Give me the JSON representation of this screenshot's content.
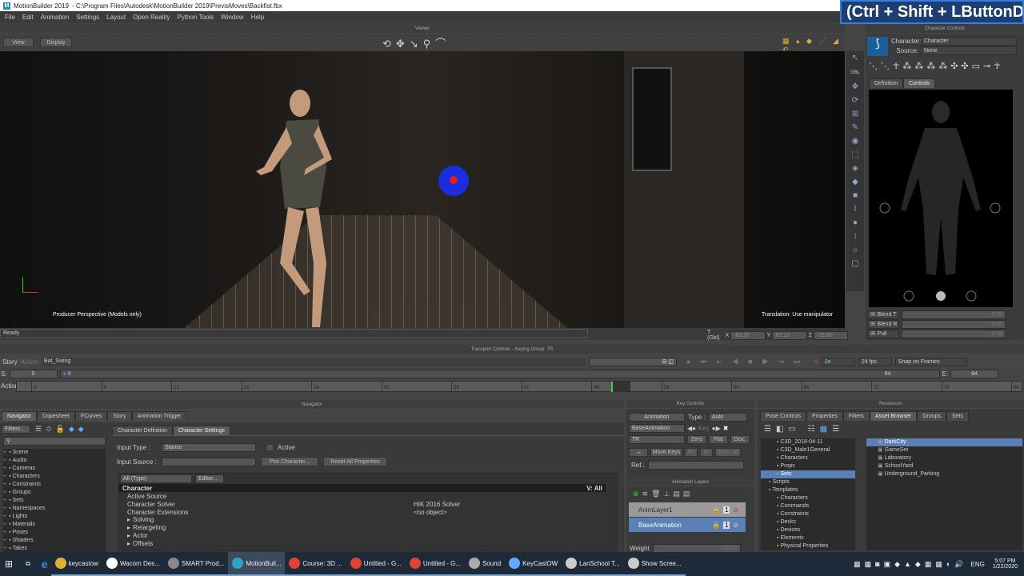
{
  "window": {
    "app_title": "MotionBuilder 2019",
    "file_path": "- C:\\Program Files\\Autodesk\\MotionBuilder 2019\\PrevisMoves\\Backfist.fbx",
    "logo": "M"
  },
  "keycast_overlay": "(Ctrl + Shift + LButtonD",
  "menu": [
    "File",
    "Edit",
    "Animation",
    "Settings",
    "Layout",
    "Open Reality",
    "Python Tools",
    "Window",
    "Help"
  ],
  "viewer": {
    "title": "Viewer",
    "view_btn": "View",
    "display_btn": "Display",
    "camera_label": "Producer Perspective (Models only)",
    "manip_label": "Translation: Use manipulator"
  },
  "status": {
    "text": "Ready",
    "coord_label": "T (Gbl)",
    "x_label": "X",
    "x": "-65.50",
    "y_label": "Y",
    "y": "87.13",
    "z_label": "Z",
    "z": "-26.60"
  },
  "character_controls": {
    "title": "Character Controls",
    "character_label": "Character:",
    "character_value": "Character",
    "source_label": "Source:",
    "source_value": "None",
    "tabs": [
      "Definition",
      "Controls"
    ],
    "active_tab": "Controls",
    "gbl": "GBL",
    "ik_rows": [
      {
        "label": "IK Blend T",
        "value": "0.00"
      },
      {
        "label": "IK Blend R",
        "value": "0.00"
      },
      {
        "label": "IK Pull",
        "value": "0.00"
      }
    ]
  },
  "transport": {
    "title": "Transport Controls - Keying Group: TR",
    "story": "Story",
    "action": "Action",
    "take": "Bat_Swing",
    "speed": "1x",
    "fps": "24 fps",
    "snap": "Snap on Frames",
    "start_label": "S:",
    "start": "0",
    "slider_start": "0",
    "end_label": "E:",
    "end": "84",
    "slider_end": "84",
    "action_label": "Action",
    "ticks": [
      "0",
      "6",
      "12",
      "18",
      "24",
      "30",
      "36",
      "42",
      "48",
      "54",
      "60",
      "66",
      "72",
      "78",
      "84"
    ],
    "current_frame_fraction": 0.6
  },
  "navigator": {
    "title": "Navigator",
    "tabs": [
      "Navigator",
      "Dopesheet",
      "FCurves",
      "Story",
      "Animation Trigger"
    ],
    "filters": "Filters...",
    "tree": [
      "Scene",
      "Audio",
      "Cameras",
      "Characters",
      "Constraints",
      "Groups",
      "Sets",
      "Namespaces",
      "Lights",
      "Materials",
      "Poses",
      "Shaders",
      "Takes"
    ],
    "char_tabs": [
      "Character Definition",
      "Character Settings"
    ],
    "input_type_label": "Input Type :",
    "input_type": "Stance",
    "active_label": "Active",
    "input_source_label": "Input Source :",
    "plot_btn": "Plot Character...",
    "reset_btn": "Reset All Properties",
    "type_filter": "All (Type)",
    "editor_btn": "Editor...",
    "group": "Character",
    "v_all": "V: All",
    "props": [
      {
        "name": "Active Source",
        "value": ""
      },
      {
        "name": "Character Solver",
        "value": "HIK 2016 Solver"
      },
      {
        "name": "Character Extensions",
        "value": "<no object>"
      }
    ],
    "subgroups": [
      "Solving",
      "Retargeting",
      "Actor",
      "Offsets"
    ]
  },
  "key_controls": {
    "title": "Key Controls",
    "mode": "Animation",
    "type_label": "Type :",
    "type": "Auto",
    "layer": "BaseAnimation",
    "key_btn": "Key",
    "group": "TR",
    "zero": "Zero",
    "flat": "Flat",
    "disc": "Disc.",
    "move_keys": "Move Keys",
    "fk": "FK",
    "ik": "IK",
    "sync": "Sync. All",
    "ref_label": "Ref.:"
  },
  "anim_layers": {
    "title": "Animation Layers",
    "layers": [
      {
        "name": "AnimLayer1",
        "selected": false
      },
      {
        "name": "BaseAnimation",
        "selected": true
      }
    ],
    "weight_label": "Weight",
    "weight": "100.00",
    "lock_num": "1"
  },
  "resources": {
    "title": "Resources",
    "tabs": [
      "Pose Controls",
      "Properties",
      "Filters",
      "Asset Browser",
      "Groups",
      "Sets"
    ],
    "active_tab": "Asset Browser",
    "tree": [
      {
        "t": "C3D_2018-04-11",
        "d": 2
      },
      {
        "t": "C3D_Male1General",
        "d": 2
      },
      {
        "t": "Characters",
        "d": 2
      },
      {
        "t": "Props",
        "d": 2
      },
      {
        "t": "Sets",
        "d": 2,
        "sel": true
      },
      {
        "t": "Scripts",
        "d": 1
      },
      {
        "t": "Templates",
        "d": 1
      },
      {
        "t": "Characters",
        "d": 2
      },
      {
        "t": "Commands",
        "d": 2
      },
      {
        "t": "Constraints",
        "d": 2
      },
      {
        "t": "Decks",
        "d": 2
      },
      {
        "t": "Devices",
        "d": 2
      },
      {
        "t": "Elements",
        "d": 2
      },
      {
        "t": "Physical Properties",
        "d": 2
      }
    ],
    "files": [
      "DarkCity",
      "GameSet",
      "Laboratory",
      "SchoolYard",
      "Underground_Parking"
    ]
  },
  "taskbar": {
    "items": [
      "keycastow",
      "Wacom Des...",
      "SMART Prod...",
      "MotionBuil...",
      "Course: 3D ...",
      "Untitled - G...",
      "Untitled - G...",
      "Sound",
      "KeyCastOW",
      "LanSchool T...",
      "Show Scree..."
    ],
    "lang": "ENG",
    "time": "5:07 PM",
    "date": "1/22/2020"
  }
}
